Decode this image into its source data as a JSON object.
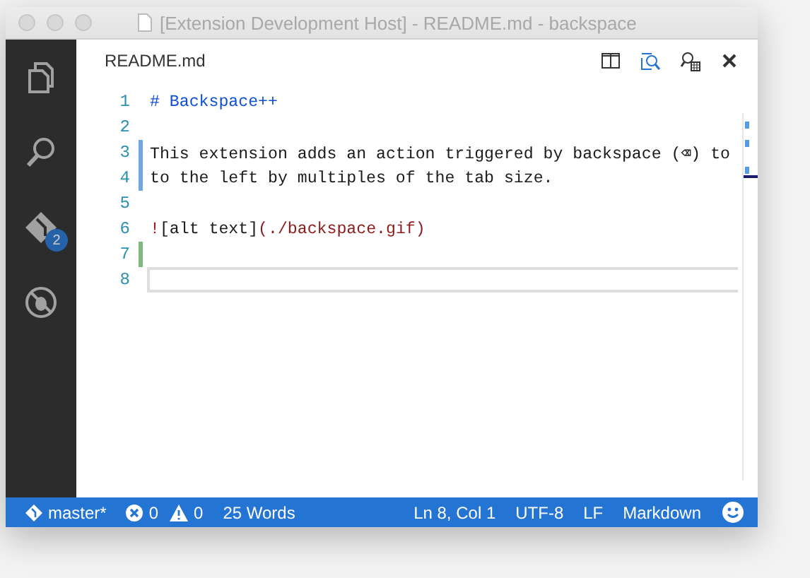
{
  "window": {
    "title": "[Extension Development Host] - README.md - backspace"
  },
  "activity_bar": [
    {
      "kind": "files",
      "selected": false
    },
    {
      "kind": "search",
      "selected": false
    },
    {
      "kind": "git",
      "selected": false,
      "badge": "2"
    },
    {
      "kind": "debug",
      "selected": false
    }
  ],
  "editor": {
    "file_name": "README.md",
    "lines": [
      {
        "number": "1",
        "modified": false,
        "added": false,
        "current": false,
        "tokens": [
          {
            "kind": "heading",
            "text": "# Backspace++"
          }
        ]
      },
      {
        "number": "2",
        "modified": false,
        "added": false,
        "current": false
      },
      {
        "number": "3",
        "modified": true,
        "added": false,
        "current": false,
        "tokens": [
          {
            "kind": "plain",
            "text": "This extension adds an action triggered by backspace (⌫) to"
          }
        ]
      },
      {
        "number": "4",
        "modified": true,
        "added": false,
        "current": false,
        "tokens": [
          {
            "kind": "plain",
            "text": "to the left by multiples of the tab size."
          }
        ]
      },
      {
        "number": "5",
        "modified": false,
        "added": false,
        "current": false
      },
      {
        "number": "6",
        "modified": false,
        "added": false,
        "current": false,
        "tokens": [
          {
            "kind": "mark",
            "text": "!"
          },
          {
            "kind": "plain",
            "text": "[alt text]"
          },
          {
            "kind": "link",
            "text": "(./backspace.gif)"
          }
        ]
      },
      {
        "number": "7",
        "modified": false,
        "added": true,
        "current": false
      },
      {
        "number": "8",
        "modified": false,
        "added": false,
        "current": true
      }
    ]
  },
  "status_bar": {
    "branch": "master*",
    "errors": "0",
    "warnings": "0",
    "words": "25 Words",
    "position": "Ln 8, Col 1",
    "encoding": "UTF-8",
    "eol": "LF",
    "language": "Markdown"
  }
}
